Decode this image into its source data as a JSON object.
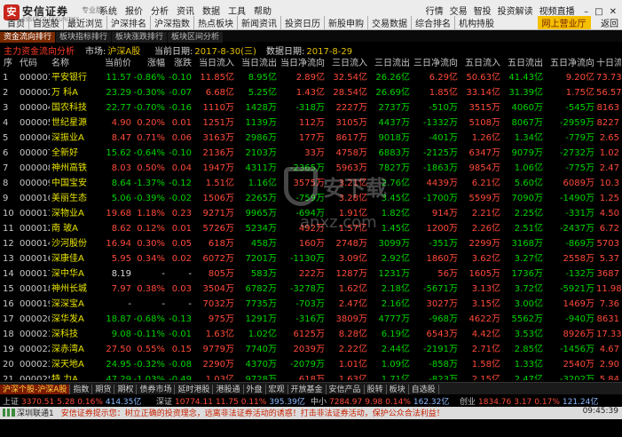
{
  "app": {
    "logo_mark": "安",
    "name": "安信证券",
    "name_sub": "ESSENCE SECURITIES",
    "edition": "专业版",
    "menu": [
      "系统",
      "报价",
      "分析",
      "资讯",
      "数据",
      "工具",
      "帮助"
    ],
    "right_menu": [
      "行情",
      "交易",
      "智投",
      "投资解读",
      "视频直播",
      "机构持股"
    ],
    "toolbar": [
      "首页",
      "自选股",
      "最近浏览",
      "沪深排名",
      "沪深指数",
      "热点板块",
      "新闻资讯",
      "投资日历",
      "新股申购",
      "交易数据",
      "综合排名",
      "机构持股"
    ],
    "online_btn": "网上营业厅",
    "back_btn": "返回"
  },
  "subbar": {
    "items": [
      "资金流向排行",
      "板块指标排行",
      "板块涨跌排行",
      "板块区间分析"
    ],
    "active_index": 0
  },
  "info": {
    "mode": "主力资金流向分析",
    "market_label": "市场:",
    "market_value": "沪深A股",
    "date_label": "当前日期:",
    "date_value": "2017-8-30(三)",
    "data_date_label": "数据日期:",
    "data_date_value": "2017-8-29"
  },
  "table": {
    "columns": [
      "序",
      "代码",
      "名称",
      "当前价",
      "涨幅",
      "涨跌",
      "当日流入",
      "当日流出",
      "当日净流向",
      "三日流入",
      "三日流出",
      "三日净流向",
      "五日流入",
      "五日流出",
      "五日净流向",
      "十日流"
    ],
    "rows": [
      {
        "i": "1",
        "code": "000001",
        "name": "平安银行",
        "price": "11.57",
        "pct": "-0.86%",
        "chg": "-0.10",
        "in1": "11.85亿",
        "out1": "8.95亿",
        "net1": "2.89亿",
        "in3": "32.54亿",
        "out3": "26.26亿",
        "net3": "6.29亿",
        "in5": "50.63亿",
        "out5": "41.43亿",
        "net5": "9.20亿",
        "in10": "73.73"
      },
      {
        "i": "2",
        "code": "000002",
        "name": "万 科A",
        "price": "23.29",
        "pct": "-0.30%",
        "chg": "-0.07",
        "in1": "6.68亿",
        "out1": "5.25亿",
        "net1": "1.43亿",
        "in3": "28.54亿",
        "out3": "26.69亿",
        "net3": "1.85亿",
        "in5": "33.14亿",
        "out5": "31.39亿",
        "net5": "1.75亿",
        "in10": "56.57"
      },
      {
        "i": "3",
        "code": "000004",
        "name": "国农科技",
        "price": "22.77",
        "pct": "-0.70%",
        "chg": "-0.16",
        "in1": "1110万",
        "out1": "1428万",
        "net1": "-318万",
        "in3": "2227万",
        "out3": "2737万",
        "net3": "-510万",
        "in5": "3515万",
        "out5": "4060万",
        "net5": "-545万",
        "in10": "8163"
      },
      {
        "i": "4",
        "code": "000005",
        "name": "世纪星源",
        "price": "4.90",
        "pct": "0.20%",
        "chg": "0.01",
        "in1": "1251万",
        "out1": "1139万",
        "net1": "112万",
        "in3": "3105万",
        "out3": "4437万",
        "net3": "-1332万",
        "in5": "5108万",
        "out5": "8067万",
        "net5": "-2959万",
        "in10": "8227"
      },
      {
        "i": "5",
        "code": "000006",
        "name": "深振业A",
        "price": "8.47",
        "pct": "0.71%",
        "chg": "0.06",
        "in1": "3163万",
        "out1": "2986万",
        "net1": "177万",
        "in3": "8617万",
        "out3": "9018万",
        "net3": "-401万",
        "in5": "1.26亿",
        "out5": "1.34亿",
        "net5": "-779万",
        "in10": "2.65"
      },
      {
        "i": "6",
        "code": "000007",
        "name": "全新好",
        "price": "15.62",
        "pct": "-0.64%",
        "chg": "-0.10",
        "in1": "2136万",
        "out1": "2103万",
        "net1": "33万",
        "in3": "4758万",
        "out3": "6883万",
        "net3": "-2125万",
        "in5": "6347万",
        "out5": "9079万",
        "net5": "-2732万",
        "in10": "1.02"
      },
      {
        "i": "7",
        "code": "000008",
        "name": "神州高铁",
        "price": "8.03",
        "pct": "0.50%",
        "chg": "0.04",
        "in1": "1947万",
        "out1": "4311万",
        "net1": "-2365万",
        "in3": "5963万",
        "out3": "7827万",
        "net3": "-1863万",
        "in5": "9854万",
        "out5": "1.06亿",
        "net5": "-775万",
        "in10": "2.47"
      },
      {
        "i": "8",
        "code": "000009",
        "name": "中国宝安",
        "price": "8.64",
        "pct": "-1.37%",
        "chg": "-0.12",
        "in1": "1.51亿",
        "out1": "1.16亿",
        "net1": "3575万",
        "in3": "3.21亿",
        "out3": "2.76亿",
        "net3": "4439万",
        "in5": "6.21亿",
        "out5": "5.60亿",
        "net5": "6089万",
        "in10": "10.3"
      },
      {
        "i": "9",
        "code": "000010",
        "name": "美丽生态",
        "price": "5.06",
        "pct": "-0.39%",
        "chg": "-0.02",
        "in1": "1506万",
        "out1": "2265万",
        "net1": "-759万",
        "in3": "3.28亿",
        "out3": "3.45亿",
        "net3": "-1700万",
        "in5": "5599万",
        "out5": "7090万",
        "net5": "-1490万",
        "in10": "1.25"
      },
      {
        "i": "10",
        "code": "000011",
        "name": "深物业A",
        "price": "19.68",
        "pct": "1.18%",
        "chg": "0.23",
        "in1": "9271万",
        "out1": "9965万",
        "net1": "-694万",
        "in3": "1.91亿",
        "out3": "1.82亿",
        "net3": "914万",
        "in5": "2.21亿",
        "out5": "2.25亿",
        "net5": "-331万",
        "in10": "4.50"
      },
      {
        "i": "11",
        "code": "000012",
        "name": "南 玻A",
        "price": "8.62",
        "pct": "0.12%",
        "chg": "0.01",
        "in1": "5726万",
        "out1": "5234万",
        "net1": "492万",
        "in3": "1.57亿",
        "out3": "1.45亿",
        "net3": "1200万",
        "in5": "2.26亿",
        "out5": "2.51亿",
        "net5": "-2437万",
        "in10": "6.72"
      },
      {
        "i": "12",
        "code": "000014",
        "name": "沙河股份",
        "price": "16.94",
        "pct": "0.30%",
        "chg": "0.05",
        "in1": "618万",
        "out1": "458万",
        "net1": "160万",
        "in3": "2748万",
        "out3": "3099万",
        "net3": "-351万",
        "in5": "2299万",
        "out5": "3168万",
        "net5": "-869万",
        "in10": "5703"
      },
      {
        "i": "13",
        "code": "000016",
        "name": "深康佳A",
        "price": "5.95",
        "pct": "0.34%",
        "chg": "0.02",
        "in1": "6072万",
        "out1": "7201万",
        "net1": "-1130万",
        "in3": "3.09亿",
        "out3": "2.92亿",
        "net3": "1860万",
        "in5": "3.62亿",
        "out5": "3.27亿",
        "net5": "2558万",
        "in10": "5.37"
      },
      {
        "i": "14",
        "code": "000017",
        "name": "深中华A",
        "price": "8.19",
        "pct": "-",
        "chg": "-",
        "in1": "805万",
        "out1": "583万",
        "net1": "222万",
        "in3": "1287万",
        "out3": "1231万",
        "net3": "56万",
        "in5": "1605万",
        "out5": "1736万",
        "net5": "-132万",
        "in10": "3687"
      },
      {
        "i": "15",
        "code": "000018",
        "name": "神州长城",
        "price": "7.97",
        "pct": "0.38%",
        "chg": "0.03",
        "in1": "3504万",
        "out1": "6782万",
        "net1": "-3278万",
        "in3": "1.62亿",
        "out3": "2.18亿",
        "net3": "-5671万",
        "in5": "3.13亿",
        "out5": "3.72亿",
        "net5": "-5921万",
        "in10": "11.98"
      },
      {
        "i": "16",
        "code": "000019",
        "name": "深深宝A",
        "price": "-",
        "pct": "-",
        "chg": "-",
        "in1": "7032万",
        "out1": "7735万",
        "net1": "-703万",
        "in3": "2.47亿",
        "out3": "2.16亿",
        "net3": "3027万",
        "in5": "3.15亿",
        "out5": "3.00亿",
        "net5": "1469万",
        "in10": "7.36"
      },
      {
        "i": "17",
        "code": "000020",
        "name": "深华发A",
        "price": "18.87",
        "pct": "-0.68%",
        "chg": "-0.13",
        "in1": "975万",
        "out1": "1291万",
        "net1": "-316万",
        "in3": "3809万",
        "out3": "4777万",
        "net3": "-968万",
        "in5": "4622万",
        "out5": "5562万",
        "net5": "-940万",
        "in10": "8631"
      },
      {
        "i": "18",
        "code": "000021",
        "name": "深科技",
        "price": "9.08",
        "pct": "-0.11%",
        "chg": "-0.01",
        "in1": "1.63亿",
        "out1": "1.02亿",
        "net1": "6125万",
        "in3": "8.28亿",
        "out3": "6.19亿",
        "net3": "6543万",
        "in5": "4.42亿",
        "out5": "3.53亿",
        "net5": "8926万",
        "in10": "17.33"
      },
      {
        "i": "19",
        "code": "000022",
        "name": "深赤湾A",
        "price": "27.50",
        "pct": "0.55%",
        "chg": "0.15",
        "in1": "9779万",
        "out1": "7740万",
        "net1": "2039万",
        "in3": "2.22亿",
        "out3": "2.44亿",
        "net3": "-2191万",
        "in5": "2.71亿",
        "out5": "2.85亿",
        "net5": "-1456万",
        "in10": "4.67"
      },
      {
        "i": "20",
        "code": "000023",
        "name": "深天地A",
        "price": "24.95",
        "pct": "-0.32%",
        "chg": "-0.08",
        "in1": "2290万",
        "out1": "4370万",
        "net1": "-2079万",
        "in3": "1.01亿",
        "out3": "1.09亿",
        "net3": "-858万",
        "in5": "1.58亿",
        "out5": "1.33亿",
        "net5": "2540万",
        "in10": "2.90"
      },
      {
        "i": "21",
        "code": "000025",
        "name": "特 力A",
        "price": "47.29",
        "pct": "-1.03%",
        "chg": "-0.49",
        "in1": "1.03亿",
        "out1": "9728万",
        "net1": "618万",
        "in3": "1.63亿",
        "out3": "1.71亿",
        "net3": "-823万",
        "in5": "2.15亿",
        "out5": "2.47亿",
        "net5": "-3202万",
        "in10": "5.84"
      }
    ]
  },
  "tabs": {
    "items": [
      "沪深个股-沪深A股",
      "指数",
      "期货",
      "期权",
      "债券市场",
      "延时港股",
      "港股通",
      "外盘",
      "宏观",
      "开放基金",
      "安信产品",
      "股转",
      "板块",
      "自选股"
    ],
    "active_index": 0
  },
  "indices": [
    {
      "name": "上证",
      "value": "3370.51",
      "change": "5.28",
      "pct": "0.16%",
      "amount": "414.35亿"
    },
    {
      "name": "深证",
      "value": "10774.11",
      "change": "11.75",
      "pct": "0.11%",
      "amount": "395.39亿"
    },
    {
      "name": "中小",
      "value": "7284.97",
      "change": "9.98",
      "pct": "0.14%",
      "amount": "162.32亿"
    },
    {
      "name": "创业",
      "value": "1834.76",
      "change": "3.17",
      "pct": "0.17%",
      "amount": "121.24亿"
    }
  ],
  "status": {
    "connection": "深圳联通1",
    "notice": "安信证券提示您：树立正确的投资理念，远离非法证券活动的诱惑！打击非法证券活动，保护公众合法利益！",
    "time": "09:45:39"
  },
  "colors": {
    "up": "#ff4a3a",
    "down": "#00d400",
    "name": "#e8e400",
    "accent": "#c8261d"
  },
  "watermark": {
    "text": "安下载",
    "domain": "anxz.com"
  }
}
